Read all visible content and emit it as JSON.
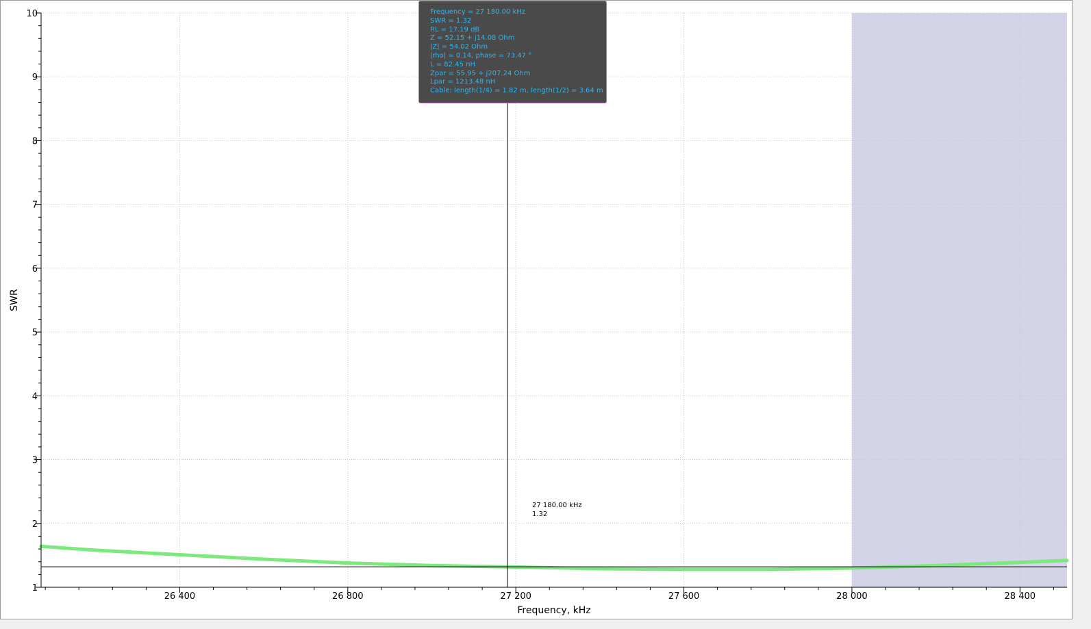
{
  "chart_data": {
    "type": "line",
    "xlabel": "Frequency, kHz",
    "ylabel": "SWR",
    "xlim": [
      26070,
      28512
    ],
    "ylim": [
      1,
      10
    ],
    "x_ticks": [
      26400,
      26800,
      27200,
      27600,
      28000,
      28400
    ],
    "x_tick_labels": [
      "26 400",
      "26 800",
      "27 200",
      "27 600",
      "28 000",
      "28 400"
    ],
    "y_ticks": [
      1,
      2,
      3,
      4,
      5,
      6,
      7,
      8,
      9,
      10
    ],
    "y_tick_labels": [
      "1",
      "2",
      "3",
      "4",
      "5",
      "6",
      "7",
      "8",
      "9",
      "10"
    ],
    "grid": true,
    "highlight_band": {
      "x_start": 28000,
      "x_end": 28512,
      "color": "#d4d4e8"
    },
    "series": [
      {
        "color": "#7de87d",
        "x": [
          26070,
          26200,
          26400,
          26600,
          26800,
          27000,
          27180,
          27400,
          27600,
          27800,
          28000,
          28200,
          28400,
          28512
        ],
        "y": [
          1.64,
          1.58,
          1.51,
          1.44,
          1.38,
          1.34,
          1.32,
          1.29,
          1.28,
          1.28,
          1.3,
          1.34,
          1.39,
          1.42
        ]
      }
    ],
    "marker": {
      "x": 27180,
      "y": 1.32,
      "label_freq": "27 180.00 kHz",
      "label_value": "1.32"
    }
  },
  "tooltip": {
    "lines": [
      "Frequency = 27 180.00 kHz",
      "SWR = 1.32",
      "RL = 17.19 dB",
      "Z = 52.15 + j14.08 Ohm",
      "|Z| = 54.02 Ohm",
      "|rho| = 0.14, phase = 73.47 °",
      "L = 82.45 nH",
      "Zpar = 55.95 + j207.24 Ohm",
      "Lpar = 1213.48 nH",
      "Cable: length(1/4) = 1.82 m, length(1/2) = 3.64 m"
    ]
  }
}
